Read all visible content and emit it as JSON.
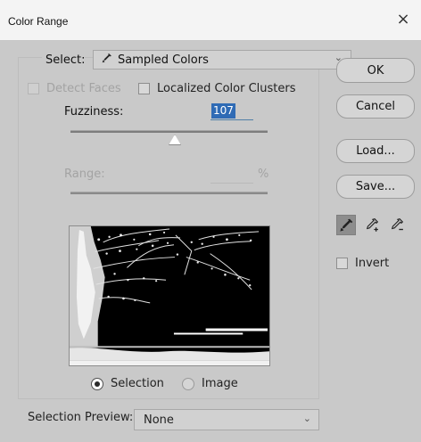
{
  "window": {
    "title": "Color Range",
    "close_icon": "×"
  },
  "select": {
    "label": "Select:",
    "value": "Sampled Colors",
    "icon": "eyedropper-icon"
  },
  "checks": {
    "detect_faces": "Detect Faces",
    "localized": "Localized Color Clusters"
  },
  "fuzziness": {
    "label": "Fuzziness:",
    "value": "107"
  },
  "range": {
    "label": "Range:",
    "unit": "%"
  },
  "radios": {
    "selection": "Selection",
    "image": "Image"
  },
  "selection_preview": {
    "label": "Selection Preview:",
    "value": "None"
  },
  "buttons": {
    "ok": "OK",
    "cancel": "Cancel",
    "load": "Load...",
    "save": "Save..."
  },
  "invert": {
    "label": "Invert"
  },
  "colors": {
    "background": "#c9c9c9",
    "selection_highlight": "#2f6bb5"
  }
}
